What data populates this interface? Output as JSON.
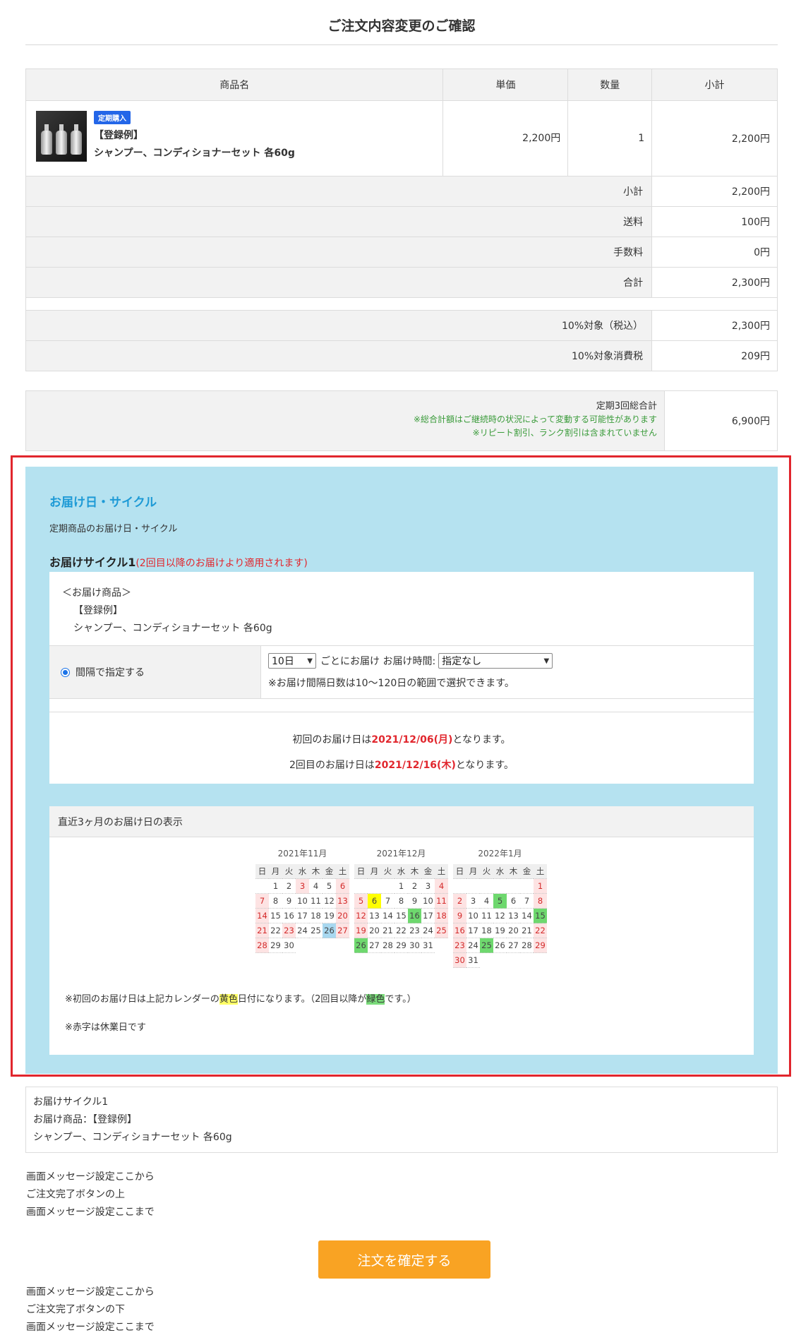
{
  "page_title": "ご注文内容変更のご確認",
  "table": {
    "headers": {
      "name": "商品名",
      "price": "単価",
      "qty": "数量",
      "subtotal": "小計"
    },
    "item": {
      "badge": "定期購入",
      "name_line1": "【登録例】",
      "name_line2": "シャンプー、コンディショナーセット 各60g",
      "price": "2,200円",
      "qty": "1",
      "subtotal": "2,200円"
    },
    "summary": [
      {
        "label": "小計",
        "value": "2,200円"
      },
      {
        "label": "送料",
        "value": "100円"
      },
      {
        "label": "手数料",
        "value": "0円"
      },
      {
        "label": "合計",
        "value": "2,300円"
      }
    ],
    "tax": [
      {
        "label": "10%対象（税込）",
        "value": "2,300円"
      },
      {
        "label": "10%対象消費税",
        "value": "209円"
      }
    ]
  },
  "total3": {
    "label": "定期3回総合計",
    "note1": "※総合計額はご継続時の状況によって変動する可能性があります",
    "note2": "※リピート割引、ランク割引は含まれていません",
    "value": "6,900円"
  },
  "delivery": {
    "title": "お届け日・サイクル",
    "subtitle": "定期商品のお届け日・サイクル",
    "cycle_title": "お届けサイクル1",
    "cycle_note": "(2回目以降のお届けより適用されます)",
    "product_label": "＜お届け商品＞",
    "product_line1": "【登録例】",
    "product_line2": "シャンプー、コンディショナーセット 各60g",
    "radio_label": "間隔で指定する",
    "interval_value": "10日",
    "interval_text": "ごとにお届け お届け時間:",
    "time_value": "指定なし",
    "range_note": "※お届け間隔日数は10〜120日の範囲で選択できます。",
    "first_prefix": "初回のお届け日は",
    "first_date": "2021/12/06(月)",
    "first_suffix": "となります。",
    "second_prefix": "2回目のお届け日は",
    "second_date": "2021/12/16(木)",
    "second_suffix": "となります。",
    "calendar_header": "直近3ヶ月のお届け日の表示",
    "note_prefix": "※初回のお届け日は上記カレンダーの",
    "note_yellow": "黄色",
    "note_mid": "日付になります。（2回目以降が",
    "note_green": "緑色",
    "note_suffix": "です。）",
    "holiday_note": "※赤字は休業日です"
  },
  "calendars": {
    "weekdays": [
      "日",
      "月",
      "火",
      "水",
      "木",
      "金",
      "土"
    ],
    "months": [
      {
        "title": "2021年11月",
        "start": 1,
        "days": 30,
        "off": [
          3,
          6,
          7,
          13,
          14,
          20,
          21,
          23,
          27,
          28
        ],
        "yellow": [],
        "green": [],
        "blue": [
          26
        ]
      },
      {
        "title": "2021年12月",
        "start": 3,
        "days": 31,
        "off": [
          4,
          5,
          11,
          12,
          18,
          19,
          25,
          26
        ],
        "yellow": [
          6
        ],
        "green": [
          16,
          26
        ],
        "blue": []
      },
      {
        "title": "2022年1月",
        "start": 6,
        "days": 31,
        "off": [
          1,
          2,
          8,
          9,
          15,
          16,
          22,
          23,
          29,
          30
        ],
        "yellow": [],
        "green": [
          5,
          15,
          25
        ],
        "blue": []
      }
    ]
  },
  "summary_box": {
    "line1": "お届けサイクル1",
    "line2": "お届け商品：【登録例】",
    "line3": "シャンプー、コンディショナーセット 各60g"
  },
  "messages_top": [
    "画面メッセージ設定ここから",
    "ご注文完了ボタンの上",
    "画面メッセージ設定ここまで"
  ],
  "confirm_button": "注文を確定する",
  "messages_bottom": [
    "画面メッセージ設定ここから",
    "ご注文完了ボタンの下",
    "画面メッセージ設定ここまで"
  ]
}
